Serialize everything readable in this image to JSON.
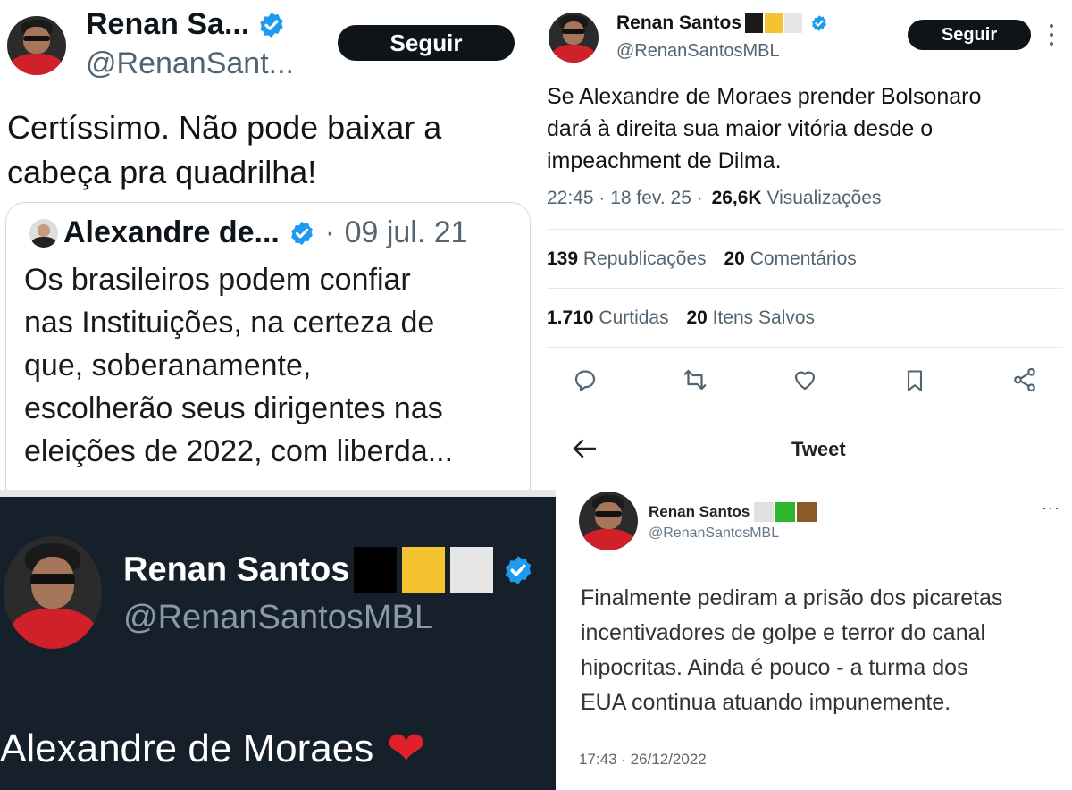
{
  "panel1": {
    "name": "Renan Sa...",
    "handle": "@RenanSant...",
    "follow_label": "Seguir",
    "text_line1": "Certíssimo. Não pode baixar a",
    "text_line2": "cabeça pra quadrilha!",
    "quote": {
      "name": "Alexandre de...",
      "sep": "·",
      "date": "09 jul. 21",
      "lines": [
        "Os brasileiros podem confiar",
        "nas Instituições, na certeza de",
        "que, soberanamente,",
        "escolherão seus dirigentes nas",
        "eleições de 2022, com liberda..."
      ]
    }
  },
  "panel2": {
    "name": "Renan Santos",
    "handle": "@RenanSantosMBL",
    "follow_label": "Seguir",
    "more_icon": "more-vertical-icon",
    "text_lines": [
      "Se Alexandre de Moraes prender Bolsonaro",
      "dará à direita sua maior vitória desde o",
      "impeachment de Dilma."
    ],
    "meta_time": "22:45 · 18 fev. 25 ·",
    "meta_views_count": "26,6K",
    "meta_views_label": "Visualizações",
    "stats": {
      "reposts_count": "139",
      "reposts_label": "Republicações",
      "comments_count": "20",
      "comments_label": "Comentários",
      "likes_count": "1.710",
      "likes_label": "Curtidas",
      "saves_count": "20",
      "saves_label": "Itens Salvos"
    },
    "actions": [
      "reply-icon",
      "retweet-icon",
      "like-icon",
      "bookmark-icon",
      "share-icon"
    ],
    "flag_colors": [
      "#1a1a1a",
      "#f4c430",
      "#e6e6e6"
    ]
  },
  "panel3": {
    "name": "Renan Santos",
    "handle": "@RenanSantosMBL",
    "text": "Alexandre de Moraes",
    "emoji": "❤",
    "flag_colors": [
      "#000000",
      "#f4c430",
      "#e6e6e6"
    ]
  },
  "panel4": {
    "back_icon": "back-arrow-icon",
    "title": "Tweet",
    "name": "Renan Santos",
    "handle": "@RenanSantosMBL",
    "more": "···",
    "text_lines": [
      "Finalmente pediram a prisão dos picaretas",
      "incentivadores de golpe e terror do canal",
      "hipocritas. Ainda é pouco - a turma dos",
      "EUA continua atuando impunemente."
    ],
    "timestamp": "17:43 · 26/12/2022",
    "flag_colors": [
      "#e0e0e0",
      "#2fb52f",
      "#8b5a2b"
    ]
  },
  "colors": {
    "verified_blue": "#1d9bf0",
    "dark_bg": "#15202b",
    "text_gray": "#536471"
  }
}
